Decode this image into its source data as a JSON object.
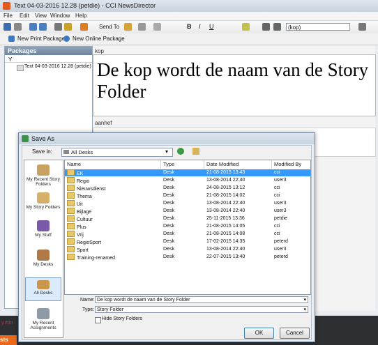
{
  "window": {
    "title": "Text 04-03-2016 12.28 (petdie) - CCI NewsDirector"
  },
  "menu": [
    "File",
    "Edit",
    "View",
    "Window",
    "Help"
  ],
  "toolbar": {
    "send_to": "Send To",
    "style_select": "(kop)"
  },
  "toolbar2": {
    "new_print": "New Print Package",
    "new_online": "New Online Package"
  },
  "packages": {
    "title": "Packages",
    "filter": "Y",
    "item": "Text 04-03-2016 12.28 (petdie)"
  },
  "editor": {
    "field1_label": "kop",
    "headline": "De kop wordt de naam van de Story Folder",
    "field2_label": "aanhef"
  },
  "dialog": {
    "title": "Save As",
    "save_in_label": "Save in:",
    "save_in_value": "All Desks",
    "places": [
      "My Recent Story Folders",
      "My Story Folders",
      "My Stuff",
      "My Desks",
      "All Desks",
      "My Recent Assignments"
    ],
    "columns": [
      "Name",
      "Type",
      "Date Modified",
      "Modified By"
    ],
    "rows": [
      {
        "name": "EK",
        "type": "Desk",
        "date": "21-08-2015 13:43",
        "by": "cci"
      },
      {
        "name": "Regio",
        "type": "Desk",
        "date": "13-08-2014 22:40",
        "by": "user3"
      },
      {
        "name": "Nieuwsdienst",
        "type": "Desk",
        "date": "24-08-2015 13:12",
        "by": "cci"
      },
      {
        "name": "Thema",
        "type": "Desk",
        "date": "21-08-2015 14:02",
        "by": "cci"
      },
      {
        "name": "Uit",
        "type": "Desk",
        "date": "13-08-2014 22:40",
        "by": "user3"
      },
      {
        "name": "Bijlage",
        "type": "Desk",
        "date": "13-08-2014 22:40",
        "by": "user3"
      },
      {
        "name": "Cultuur",
        "type": "Desk",
        "date": "25-11-2015 13:36",
        "by": "petdie"
      },
      {
        "name": "Plus",
        "type": "Desk",
        "date": "21-08-2015 14:05",
        "by": "cci"
      },
      {
        "name": "Vrij",
        "type": "Desk",
        "date": "21-08-2015 14:08",
        "by": "cci"
      },
      {
        "name": "RegioSport",
        "type": "Desk",
        "date": "17-02-2015 14:35",
        "by": "peterd"
      },
      {
        "name": "Sport",
        "type": "Desk",
        "date": "13-08-2014 22:40",
        "by": "user3"
      },
      {
        "name": "Training-renamed",
        "type": "Desk",
        "date": "22-07-2015 13:40",
        "by": "peterd"
      }
    ],
    "name_label": "Name:",
    "name_value": "De kop wordt de naam van de Story Folder",
    "type_label": "Type:",
    "type_value": "Story Folder",
    "hide_label": "Hide Story Folders",
    "ok_label": "OK",
    "cancel_label": "Cancel"
  },
  "strip_text": "y.min",
  "strip_text2": "sts"
}
